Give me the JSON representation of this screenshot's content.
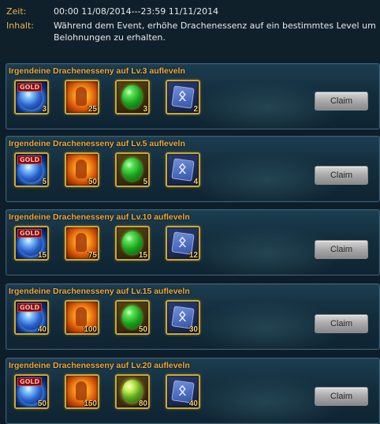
{
  "header": {
    "zeit_label": "Zeit:",
    "zeit_value": "00:00 11/08/2014---23:59 11/11/2014",
    "inhalt_label": "Inhalt:",
    "inhalt_value": "Während dem Event, erhöhe Drachenessenz auf ein bestimmtes Level um Belohnungen zu erhalten."
  },
  "tiers": [
    {
      "title": "Irgendeine Drachenesseny auf Lv.3 aufleveln",
      "claim_label": "Claim",
      "rewards": [
        {
          "icon": "blue-orb-icon",
          "tag": "GOLD",
          "qty": "3"
        },
        {
          "icon": "fire-figure-icon",
          "qty": "25"
        },
        {
          "icon": "green-gem-icon",
          "qty": "3"
        },
        {
          "icon": "blue-rune-icon",
          "qty": "2"
        }
      ]
    },
    {
      "title": "Irgendeine Drachenesseny auf Lv.5 aufleveln",
      "claim_label": "Claim",
      "rewards": [
        {
          "icon": "blue-orb-icon",
          "tag": "GOLD",
          "qty": "5"
        },
        {
          "icon": "fire-figure-icon",
          "qty": "50"
        },
        {
          "icon": "green-gem-icon",
          "qty": "5"
        },
        {
          "icon": "blue-rune-icon",
          "qty": "4"
        }
      ]
    },
    {
      "title": "Irgendeine Drachenesseny auf Lv.10 aufleveln",
      "claim_label": "Claim",
      "rewards": [
        {
          "icon": "blue-orb-icon",
          "tag": "GOLD",
          "qty": "15"
        },
        {
          "icon": "fire-figure-icon",
          "qty": "75"
        },
        {
          "icon": "green-gem-icon",
          "qty": "15"
        },
        {
          "icon": "blue-rune-icon",
          "qty": "12"
        }
      ]
    },
    {
      "title": "Irgendeine Drachenesseny auf Lv.15 aufleveln",
      "claim_label": "Claim",
      "rewards": [
        {
          "icon": "blue-orb-icon",
          "tag": "GOLD",
          "qty": "40"
        },
        {
          "icon": "fire-figure-icon",
          "qty": "100"
        },
        {
          "icon": "green-gem-icon",
          "qty": "50"
        },
        {
          "icon": "blue-rune-icon",
          "qty": "30"
        }
      ]
    },
    {
      "title": "Irgendeine Drachenesseny auf Lv.20 aufleveln",
      "claim_label": "Claim",
      "rewards": [
        {
          "icon": "blue-orb-icon",
          "tag": "GOLD",
          "qty": "50"
        },
        {
          "icon": "fire-figure-icon",
          "qty": "150"
        },
        {
          "icon": "gold-green-gem-icon",
          "qty": "80"
        },
        {
          "icon": "blue-rune-icon",
          "qty": "40"
        }
      ]
    }
  ],
  "colors": {
    "title": "#f0a83a",
    "label": "#e8b449",
    "frame": "#c9a93b",
    "panel": "#173748"
  }
}
